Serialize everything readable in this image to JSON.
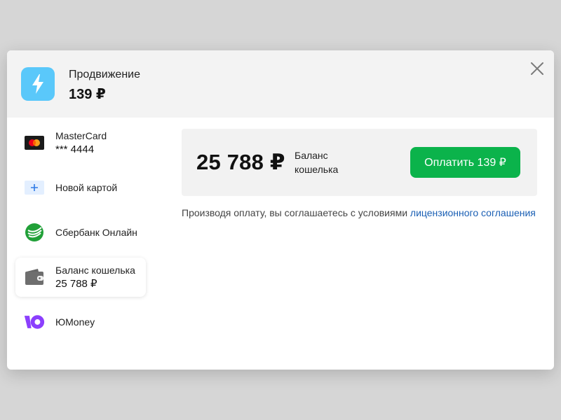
{
  "header": {
    "title": "Продвижение",
    "price": "139 ₽",
    "product_icon": "lightning-icon",
    "close_icon": "close-icon"
  },
  "payment_methods": [
    {
      "label": "MasterCard",
      "sub": "*** 4444",
      "icon": "mastercard-icon",
      "selected": false
    },
    {
      "label": "Новой картой",
      "sub": "",
      "icon": "plus-icon",
      "selected": false
    },
    {
      "label": "Сбербанк Онлайн",
      "sub": "",
      "icon": "sberbank-icon",
      "selected": false
    },
    {
      "label": "Баланс кошелька",
      "sub": "25 788 ₽",
      "icon": "wallet-icon",
      "selected": true
    },
    {
      "label": "ЮMoney",
      "sub": "",
      "icon": "yoomoney-icon",
      "selected": false
    }
  ],
  "balance": {
    "amount": "25 788 ₽",
    "label": "Баланс кошелька"
  },
  "pay_button": "Оплатить 139 ₽",
  "terms": {
    "text": "Производя оплату, вы соглашаетесь с условиями ",
    "link": "лицензионного соглашения"
  },
  "colors": {
    "accent_green": "#0bb34b",
    "link_blue": "#1a5fb4",
    "product_icon_bg": "#5ac8fa",
    "yoomoney_purple": "#8b3ffd",
    "sber_green": "#21a038"
  }
}
